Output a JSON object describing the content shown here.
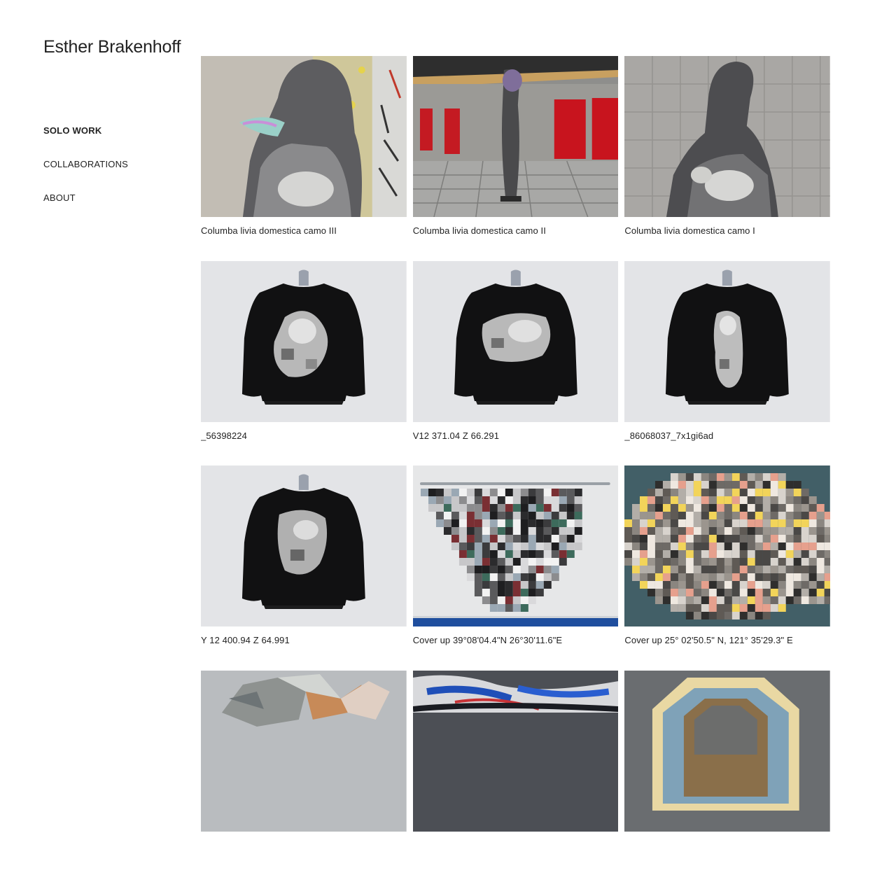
{
  "site": {
    "title": "Esther Brakenhoff"
  },
  "nav": {
    "items": [
      {
        "label": "SOLO WORK",
        "active": true
      },
      {
        "label": "COLLABORATIONS",
        "active": false
      },
      {
        "label": "ABOUT",
        "active": false
      }
    ]
  },
  "gallery": {
    "items": [
      {
        "caption": "Columba livia domestica camo III",
        "image": "hooded-figure-graffiti-wall"
      },
      {
        "caption": "Columba livia domestica camo II",
        "image": "figure-tunnel-red-doors"
      },
      {
        "caption": "Columba livia domestica camo I",
        "image": "hooded-figure-tiled-wall"
      },
      {
        "caption": "_56398224",
        "image": "black-sweater-hanger"
      },
      {
        "caption": "V12 371.04 Z 66.291",
        "image": "black-sweater-hanger"
      },
      {
        "caption": "_86068037_7x1gi6ad",
        "image": "black-sweater-hanger"
      },
      {
        "caption": "Y 12 400.94 Z 64.991",
        "image": "black-sweater-hanger"
      },
      {
        "caption": "Cover up 39°08'04.4\"N 26°30'11.6\"E",
        "image": "pixelated-textile-hanging"
      },
      {
        "caption": "Cover up 25° 02'50.5\" N, 121° 35'29.3\" E",
        "image": "pixelated-textile-floor"
      },
      {
        "caption": "",
        "image": "patchwork-textile"
      },
      {
        "caption": "",
        "image": "blue-tufted-textile"
      },
      {
        "caption": "",
        "image": "octagon-rug"
      }
    ]
  }
}
